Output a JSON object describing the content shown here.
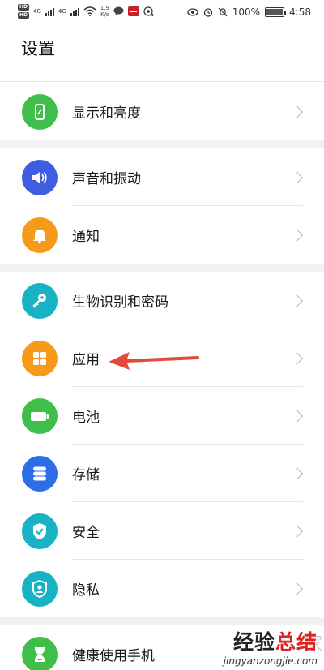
{
  "status_bar": {
    "net_speed_value": "1.9",
    "net_speed_unit": "K/s",
    "signal_1_label": "4G",
    "signal_2_label": "4G",
    "battery_percent": "100%",
    "battery_level": 1.0,
    "time": "4:58"
  },
  "page": {
    "title": "设置"
  },
  "settings": {
    "display": {
      "label": "显示和亮度",
      "icon": "phone-icon",
      "color": "#3fbf4a"
    },
    "sound": {
      "label": "声音和振动",
      "icon": "speaker-icon",
      "color": "#3f5de0"
    },
    "notifications": {
      "label": "通知",
      "icon": "bell-icon",
      "color": "#f59a1b"
    },
    "biometrics": {
      "label": "生物识别和密码",
      "icon": "key-icon",
      "color": "#17b3c4"
    },
    "apps": {
      "label": "应用",
      "icon": "apps-grid-icon",
      "color": "#f59a1b"
    },
    "battery": {
      "label": "电池",
      "icon": "battery-icon",
      "color": "#3fbf4a"
    },
    "storage": {
      "label": "存储",
      "icon": "storage-icon",
      "color": "#2d6ee8"
    },
    "security": {
      "label": "安全",
      "icon": "shield-check-icon",
      "color": "#17b3c4"
    },
    "privacy": {
      "label": "隐私",
      "icon": "privacy-shield-icon",
      "color": "#17b3c4"
    },
    "health": {
      "label": "健康使用手机",
      "icon": "hourglass-icon",
      "color": "#3fbf4a"
    }
  },
  "annotation": {
    "arrow_color": "#e24a3b"
  },
  "watermark": {
    "chinese_part1": "经验",
    "chinese_part2": "总结",
    "pinyin": "jingyanzongjie.com"
  }
}
